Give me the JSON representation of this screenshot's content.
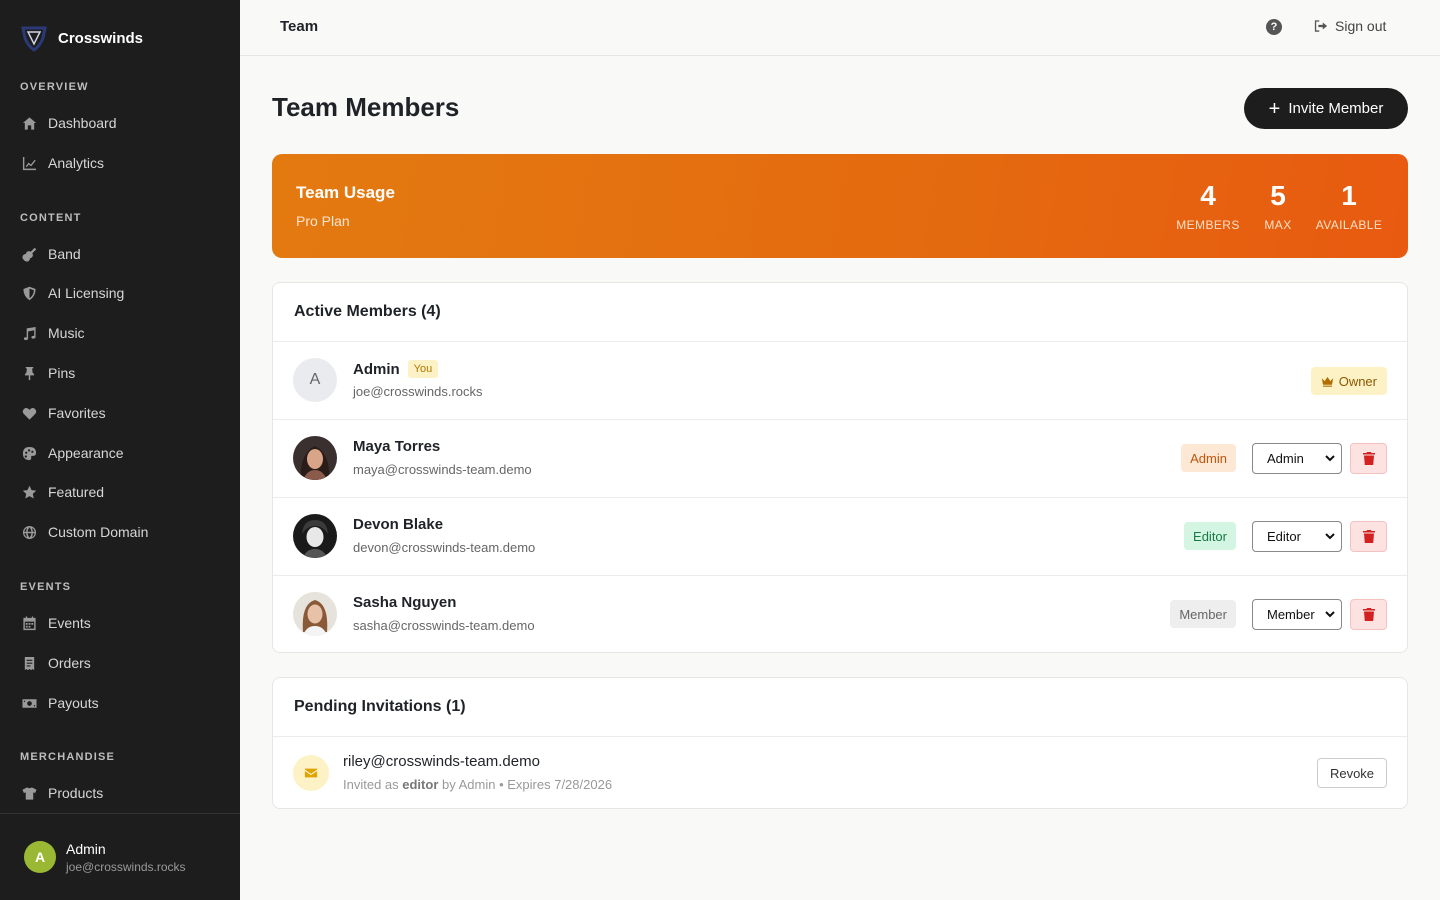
{
  "sidebar": {
    "brand": "Crosswinds",
    "sections": [
      {
        "title": "OVERVIEW",
        "items": [
          {
            "label": "Dashboard",
            "icon": "home-icon"
          },
          {
            "label": "Analytics",
            "icon": "chart-line-icon"
          }
        ]
      },
      {
        "title": "CONTENT",
        "items": [
          {
            "label": "Band",
            "icon": "guitar-icon"
          },
          {
            "label": "AI Licensing",
            "icon": "shield-icon"
          },
          {
            "label": "Music",
            "icon": "music-note-icon"
          },
          {
            "label": "Pins",
            "icon": "thumbtack-icon"
          },
          {
            "label": "Favorites",
            "icon": "heart-icon"
          },
          {
            "label": "Appearance",
            "icon": "palette-icon"
          },
          {
            "label": "Featured",
            "icon": "star-icon"
          },
          {
            "label": "Custom Domain",
            "icon": "globe-icon"
          }
        ]
      },
      {
        "title": "EVENTS",
        "items": [
          {
            "label": "Events",
            "icon": "calendar-icon"
          },
          {
            "label": "Orders",
            "icon": "receipt-icon"
          },
          {
            "label": "Payouts",
            "icon": "money-icon"
          }
        ]
      },
      {
        "title": "MERCHANDISE",
        "items": [
          {
            "label": "Products",
            "icon": "shirt-icon"
          }
        ]
      }
    ],
    "user": {
      "initial": "A",
      "name": "Admin",
      "email": "joe@crosswinds.rocks"
    }
  },
  "topbar": {
    "title": "Team",
    "help": "?",
    "signout": "Sign out"
  },
  "page": {
    "title": "Team Members",
    "invite_label": "Invite Member"
  },
  "usage": {
    "title": "Team Usage",
    "plan": "Pro Plan",
    "stats": [
      {
        "value": "4",
        "label": "MEMBERS"
      },
      {
        "value": "5",
        "label": "MAX"
      },
      {
        "value": "1",
        "label": "AVAILABLE"
      }
    ]
  },
  "members": {
    "header": "Active Members (4)",
    "you_label": "You",
    "owner_label": "Owner",
    "rows": [
      {
        "name": "Admin",
        "email": "joe@crosswinds.rocks",
        "initial": "A"
      },
      {
        "name": "Maya Torres",
        "email": "maya@crosswinds-team.demo",
        "role": "Admin",
        "select": "Admin"
      },
      {
        "name": "Devon Blake",
        "email": "devon@crosswinds-team.demo",
        "role": "Editor",
        "select": "Editor"
      },
      {
        "name": "Sasha Nguyen",
        "email": "sasha@crosswinds-team.demo",
        "role": "Member",
        "select": "Member"
      }
    ]
  },
  "invitations": {
    "header": "Pending Invitations (1)",
    "rows": [
      {
        "email": "riley@crosswinds-team.demo",
        "prefix": "Invited as ",
        "role": "editor",
        "suffix": " by Admin • Expires 7/28/2026",
        "revoke": "Revoke"
      }
    ]
  },
  "colors": {
    "sidebar_bg": "#1d1d1d",
    "accent_orange": "#e46a0f",
    "primary_button": "#1d1d1d",
    "danger": "#d32020"
  }
}
